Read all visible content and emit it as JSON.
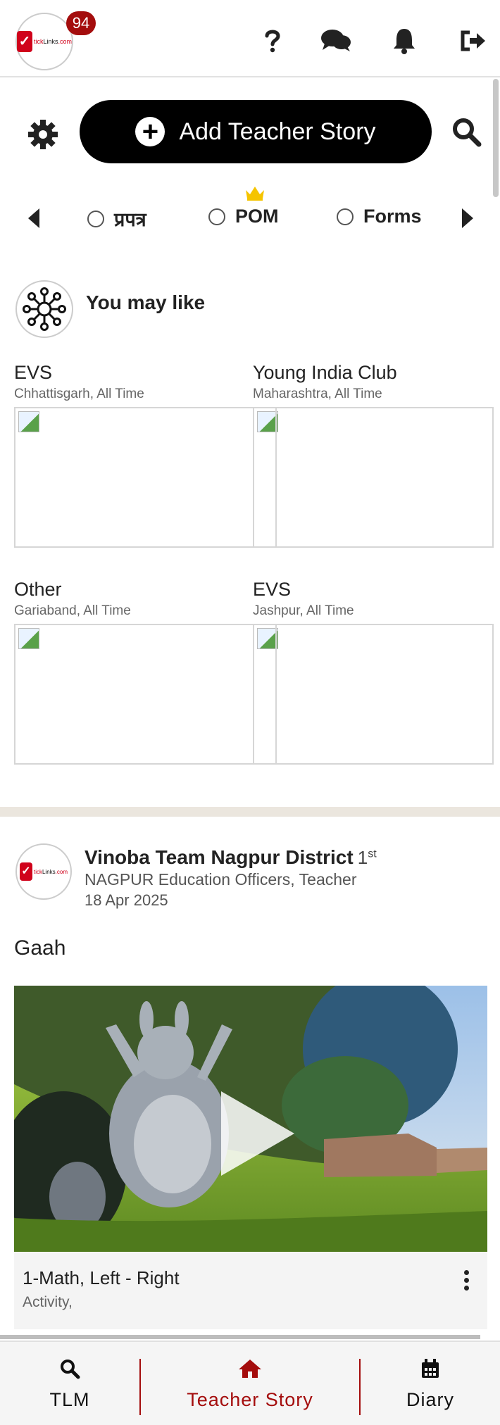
{
  "header": {
    "logo_alt": "tickLinks.com",
    "notification_count": "94",
    "icons": [
      "help-icon",
      "chat-icon",
      "bell-icon",
      "logout-icon"
    ]
  },
  "actions": {
    "add_story_label": "Add Teacher Story"
  },
  "tabs": [
    {
      "label": "प्रपत्र"
    },
    {
      "label": "POM"
    },
    {
      "label": "Forms"
    }
  ],
  "you_may_like": {
    "title": "You may like",
    "cards": [
      {
        "title": "EVS",
        "subtitle": "Chhattisgarh, All Time"
      },
      {
        "title": "Young India Club",
        "subtitle": "Maharashtra, All Time"
      },
      {
        "title": "Other",
        "subtitle": "Gariaband, All Time"
      },
      {
        "title": "EVS",
        "subtitle": "Jashpur, All Time"
      }
    ]
  },
  "post": {
    "author": "Vinoba Team Nagpur District",
    "degree": "1",
    "degree_suffix": "st",
    "role": "NAGPUR Education Officers, Teacher",
    "date": "18 Apr 2025",
    "text": "Gaah",
    "media_title": "1-Math, Left - Right",
    "media_subtitle": "Activity,"
  },
  "bottom_nav": {
    "items": [
      {
        "label": "TLM"
      },
      {
        "label": "Teacher Story"
      },
      {
        "label": "Diary"
      }
    ]
  },
  "colors": {
    "accent": "#a40d0d",
    "primary_button": "#000000"
  }
}
